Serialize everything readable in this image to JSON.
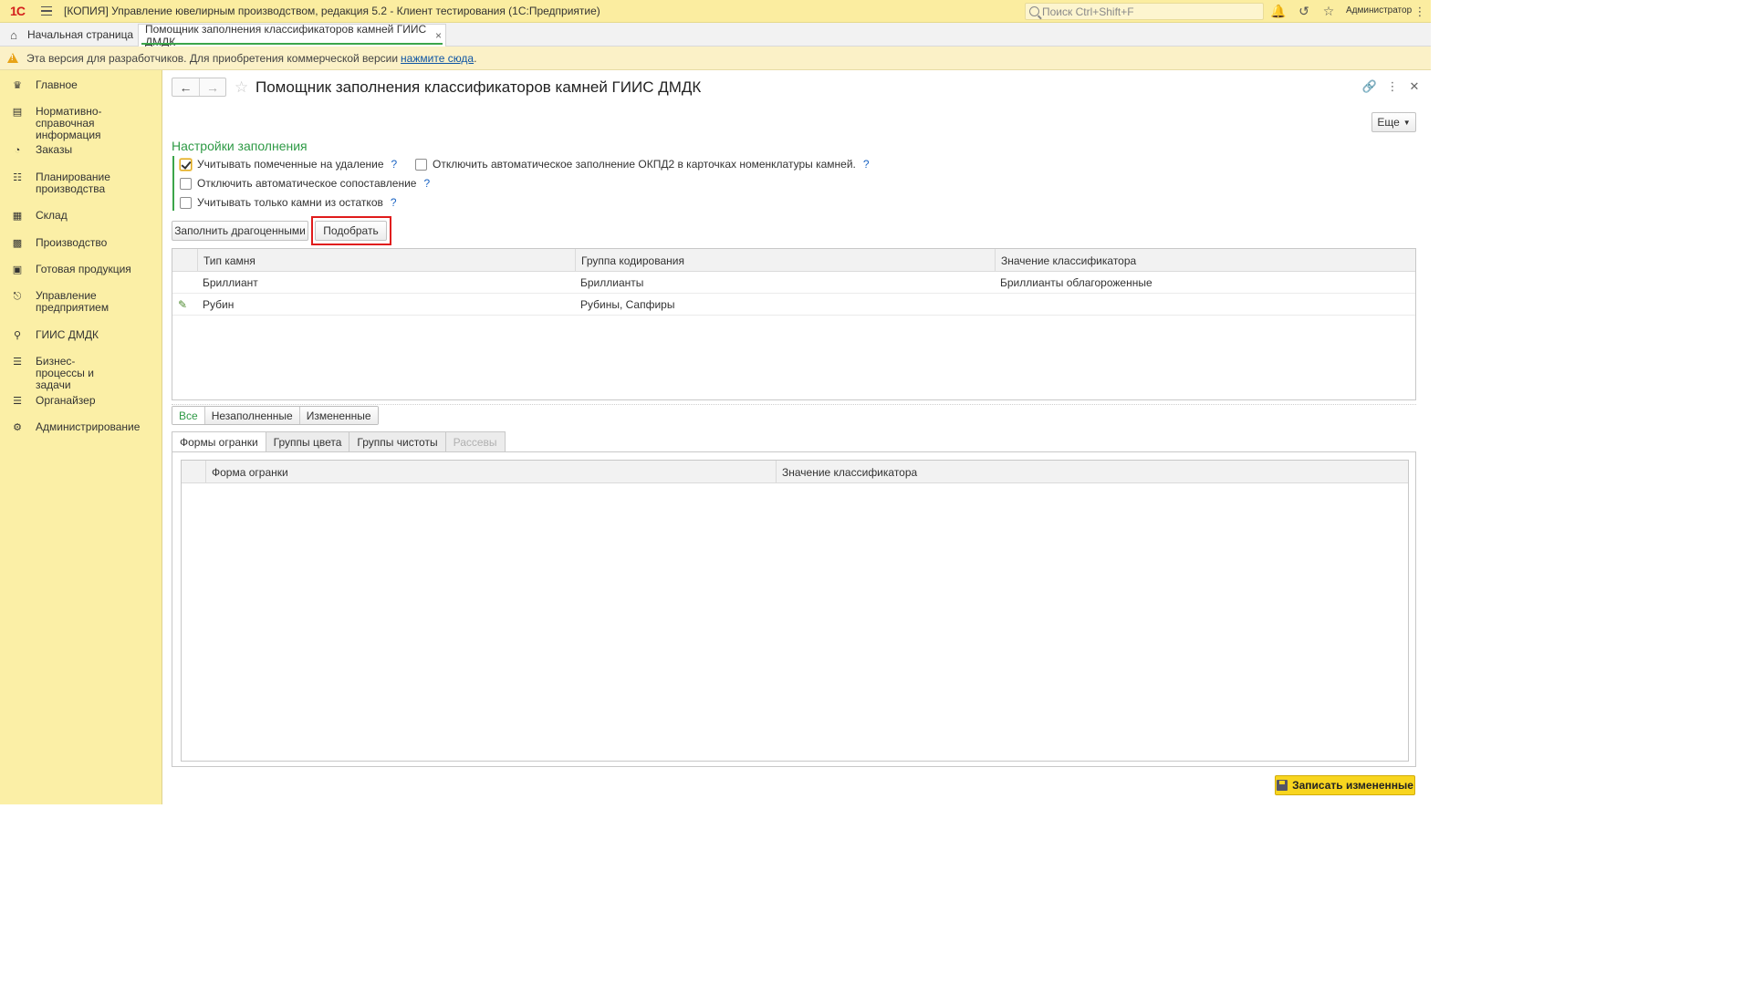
{
  "titlebar": {
    "logo": "1С",
    "title": "[КОПИЯ] Управление ювелирным производством, редакция 5.2  - Клиент тестирования (1С:Предприятие)",
    "search_placeholder": "Поиск Ctrl+Shift+F",
    "user": "Администратор"
  },
  "tabs": {
    "home_label": "Начальная страница",
    "active_label": "Помощник заполнения классификаторов камней ГИИС ДМДК"
  },
  "banner": {
    "text": "Эта версия для разработчиков. Для приобретения коммерческой версии",
    "link": "нажмите сюда",
    "suffix": "."
  },
  "sidebar": {
    "items": [
      {
        "label": "Главное",
        "icon": "crown-icon"
      },
      {
        "label": "Нормативно-справочная информация",
        "icon": "book-icon"
      },
      {
        "label": "Заказы",
        "icon": "pie-icon"
      },
      {
        "label": "Планирование производства",
        "icon": "clipboard-icon"
      },
      {
        "label": "Склад",
        "icon": "grid-icon"
      },
      {
        "label": "Производство",
        "icon": "factory-icon"
      },
      {
        "label": "Готовая продукция",
        "icon": "bag-icon"
      },
      {
        "label": "Управление предприятием",
        "icon": "org-icon"
      },
      {
        "label": "ГИИС ДМДК",
        "icon": "scan-icon"
      },
      {
        "label": "Бизнес-процессы и задачи",
        "icon": "tasks-icon"
      },
      {
        "label": "Органайзер",
        "icon": "sliders-icon"
      },
      {
        "label": "Администрирование",
        "icon": "gear-icon"
      }
    ]
  },
  "form": {
    "title": "Помощник заполнения классификаторов камней ГИИС ДМДК",
    "more_label": "Еще",
    "section_title": "Настройки заполнения",
    "checkboxes": {
      "marked_deletion": {
        "label": "Учитывать помеченные на удаление",
        "checked": true
      },
      "disable_okpd2": {
        "label": "Отключить автоматическое заполнение ОКПД2 в карточках номенклатуры камней.",
        "checked": false
      },
      "disable_matching": {
        "label": "Отключить автоматическое сопоставление",
        "checked": false
      },
      "only_stock": {
        "label": "Учитывать только камни из остатков",
        "checked": false
      }
    },
    "help_mark": "?",
    "buttons": {
      "fill_precious": "Заполнить драгоценными",
      "pick": "Подобрать"
    },
    "table1": {
      "headers": [
        "Тип камня",
        "Группа кодирования",
        "Значение классификатора"
      ],
      "rows": [
        {
          "type": "Бриллиант",
          "group": "Бриллианты",
          "value": "Бриллианты облагороженные",
          "edited": false
        },
        {
          "type": "Рубин",
          "group": "Рубины, Сапфиры",
          "value": "",
          "edited": true
        }
      ]
    },
    "filter": {
      "all": "Все",
      "unfilled": "Незаполненные",
      "changed": "Измененные"
    },
    "bottom_tabs": [
      {
        "label": "Формы огранки",
        "active": true,
        "disabled": false
      },
      {
        "label": "Группы цвета",
        "active": false,
        "disabled": false
      },
      {
        "label": "Группы чистоты",
        "active": false,
        "disabled": false
      },
      {
        "label": "Рассевы",
        "active": false,
        "disabled": true
      }
    ],
    "table2": {
      "headers": [
        "Форма огранки",
        "Значение классификатора"
      ]
    },
    "save_label": "Записать измененные"
  },
  "colors": {
    "accent_green": "#3ca54a",
    "sidebar_bg": "#fbefa6",
    "highlight_red": "#e01b1b",
    "save_yellow": "#f8d51f"
  }
}
